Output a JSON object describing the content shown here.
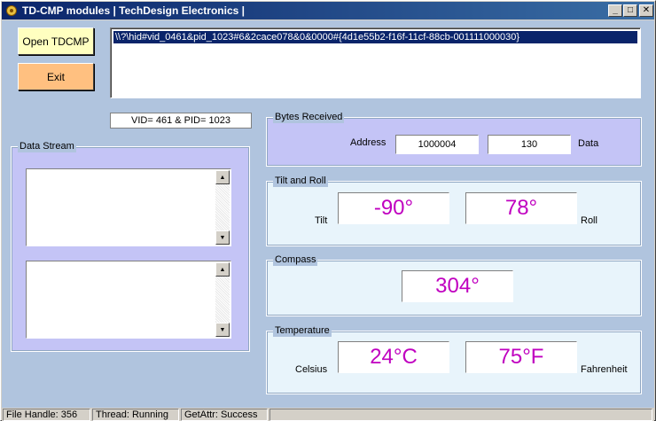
{
  "window": {
    "title": "TD-CMP modules | TechDesign Electronics |",
    "controls": {
      "minimize": "_",
      "maximize": "□",
      "close": "✕"
    },
    "icon": "app-gear-icon"
  },
  "buttons": {
    "open": "Open TDCMP",
    "exit": "Exit"
  },
  "device_list": {
    "items": [
      "\\\\?\\hid#vid_0461&pid_1023#6&2cace078&0&0000#{4d1e55b2-f16f-11cf-88cb-001111000030}"
    ]
  },
  "vidpid": "VID= 461 & PID= 1023",
  "data_stream": {
    "label": "Data Stream"
  },
  "bytes_received": {
    "label": "Bytes Received",
    "address_label": "Address",
    "address_value": "1000004",
    "data_value": "130",
    "data_label": "Data"
  },
  "tilt_roll": {
    "label": "Tilt and Roll",
    "tilt_label": "Tilt",
    "tilt_value": "-90°",
    "roll_value": "78°",
    "roll_label": "Roll"
  },
  "compass": {
    "label": "Compass",
    "value": "304°"
  },
  "temperature": {
    "label": "Temperature",
    "celsius_label": "Celsius",
    "celsius_value": "24°C",
    "fahrenheit_value": "75°F",
    "fahrenheit_label": "Fahrenheit"
  },
  "status": {
    "file_handle": "File Handle: 356",
    "thread": "Thread: Running",
    "getattr": "GetAttr: Success"
  },
  "colors": {
    "client_bg": "#b0c4de",
    "open_button": "#ffffc0",
    "exit_button": "#ffc080",
    "lavender_group": "#c4c4f6",
    "ice_group": "#e8f4fb",
    "value_text": "#c000c0",
    "selection": "#0a246a"
  }
}
